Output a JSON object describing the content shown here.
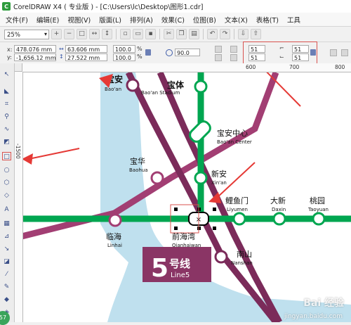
{
  "window": {
    "app_icon_letter": "C",
    "title": "CorelDRAW X4 ( 专业版 ) - [C:\\Users\\lc\\Desktop\\图形1.cdr]"
  },
  "menu": [
    "文件(F)",
    "编辑(E)",
    "视图(V)",
    "版面(L)",
    "排列(A)",
    "效果(C)",
    "位图(B)",
    "文本(X)",
    "表格(T)",
    "工具"
  ],
  "toolbar": {
    "zoom": "25%",
    "icons": [
      "zoom-in-icon",
      "zoom-out-icon",
      "zoom-page-icon",
      "zoom-width-icon",
      "zoom-height-icon",
      "new-icon",
      "open-icon",
      "save-icon",
      "cut-icon",
      "copy-icon",
      "paste-icon",
      "undo-icon",
      "redo-icon",
      "import-icon",
      "export-icon"
    ]
  },
  "properties": {
    "x_label": "x:",
    "y_label": "y:",
    "x": "478.076 mm",
    "y": "-1,656.12 mm",
    "width": "63.606 mm",
    "height": "27.522 mm",
    "scale_w": "100.0",
    "scale_h": "100.0",
    "percent": "%",
    "rotation": "90.0",
    "corner_tl": "51",
    "corner_bl": "51",
    "corner_tr": "51",
    "corner_br": "51"
  },
  "ruler": {
    "top_ticks": [
      "600",
      "700",
      "800"
    ],
    "left_ticks": [
      "-1500"
    ]
  },
  "map": {
    "stations": [
      {
        "cn": "宝安",
        "en": "Bao'an"
      },
      {
        "cn": "宝体",
        "en": "Bao'an Stadium"
      },
      {
        "cn": "宝安中心",
        "en": "Bao'an Center"
      },
      {
        "cn": "宝华",
        "en": "Baohua"
      },
      {
        "cn": "新安",
        "en": "Xin'an"
      },
      {
        "cn": "临海",
        "en": "Linhai"
      },
      {
        "cn": "前海湾",
        "en": "Qianhaiwan"
      },
      {
        "cn": "鲤鱼门",
        "en": "Liyumen"
      },
      {
        "cn": "大新",
        "en": "Daxin"
      },
      {
        "cn": "桃园",
        "en": "Taoyuan"
      },
      {
        "cn": "南山",
        "en": "Nanshan"
      }
    ],
    "line_badge_number": "5",
    "line_badge_cn": "号线",
    "line_badge_en": "Line5",
    "selected_marker": "×",
    "colors": {
      "line1": "#00a650",
      "line5": "#7b2b5a",
      "line11": "#a23e73",
      "water": "#bfe0ee"
    }
  },
  "watermark": {
    "brand": "Bai 经验",
    "url": "jingyan.baidu.com"
  },
  "badge": "57"
}
